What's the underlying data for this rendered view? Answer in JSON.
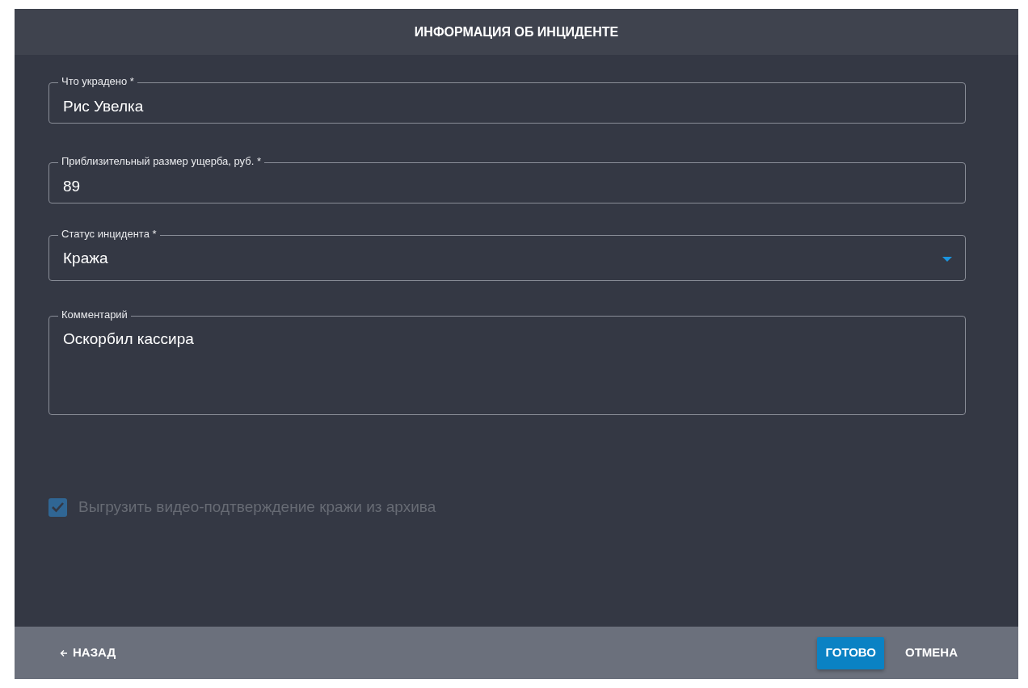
{
  "dialog": {
    "title": "ИНФОРМАЦИЯ ОБ ИНЦИДЕНТЕ"
  },
  "fields": [
    {
      "kind": "text",
      "label": "Что украдено *",
      "value": "Рис Увелка"
    },
    {
      "kind": "text",
      "label": "Приблизительный размер ущерба, руб. *",
      "value": "89"
    },
    {
      "kind": "select",
      "label": "Статус инцидента *",
      "value": "Кража"
    },
    {
      "kind": "textarea",
      "label": "Комментарий",
      "value": "Оскорбил кассира"
    }
  ],
  "checkbox": {
    "label": "Выгрузить видео-подтверждение кражи из архива",
    "checked": true,
    "disabled": true
  },
  "footer": {
    "back": "НАЗАД",
    "buttons": [
      {
        "kind": "primary",
        "label": "ГОТОВО"
      },
      {
        "kind": "flat",
        "label": "ОТМЕНА"
      }
    ]
  }
}
